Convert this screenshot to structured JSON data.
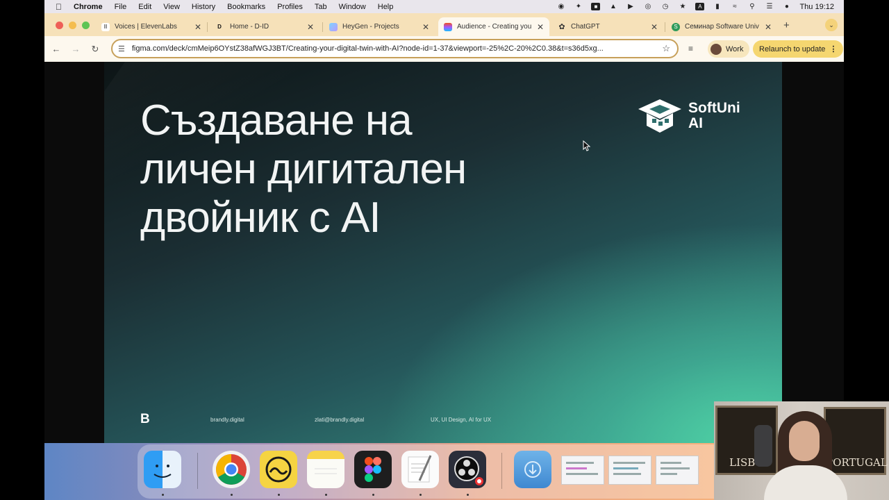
{
  "menubar": {
    "app_name": "Chrome",
    "menus": [
      "File",
      "Edit",
      "View",
      "History",
      "Bookmarks",
      "Profiles",
      "Tab",
      "Window",
      "Help"
    ],
    "clock": "Thu 19:12",
    "input_source": "A"
  },
  "tabs": [
    {
      "title": "Voices | ElevenLabs",
      "favicon": "elevenlabs-icon",
      "active": false
    },
    {
      "title": "Home - D-ID",
      "favicon": "did-icon",
      "active": false
    },
    {
      "title": "HeyGen - Projects",
      "favicon": "heygen-icon",
      "active": false
    },
    {
      "title": "Audience - Creating you",
      "favicon": "figma-icon",
      "active": true
    },
    {
      "title": "ChatGPT",
      "favicon": "chatgpt-icon",
      "active": false
    },
    {
      "title": "Семинар Software Univ",
      "favicon": "softuni-icon",
      "active": false
    }
  ],
  "toolbar": {
    "url": "figma.com/deck/cmMeip6OYstZ38afWGJ3BT/Creating-your-digital-twin-with-AI?node-id=1-37&viewport=-25%2C-20%2C0.38&t=s36d5xg...",
    "profile_label": "Work",
    "relaunch_label": "Relaunch to update"
  },
  "slide": {
    "title_lines": [
      "Създаване на",
      "личен дигитален",
      "двойник с AI"
    ],
    "logo_line1": "SoftUni",
    "logo_line2": "AI",
    "footer_mark": "B",
    "footer_site": "brandly.digital",
    "footer_email": "zlati@brandly.digital",
    "footer_topics": "UX, UI Design, AI for UX"
  },
  "webcam": {
    "poster_left": "LISBO",
    "poster_right": "PORTUGAL"
  },
  "colors": {
    "tabstrip": "#f6e1b9",
    "omnibox_border": "#c7a05a",
    "relaunch_bg": "#f5d670",
    "slide_accent": "#4fd2a5"
  }
}
